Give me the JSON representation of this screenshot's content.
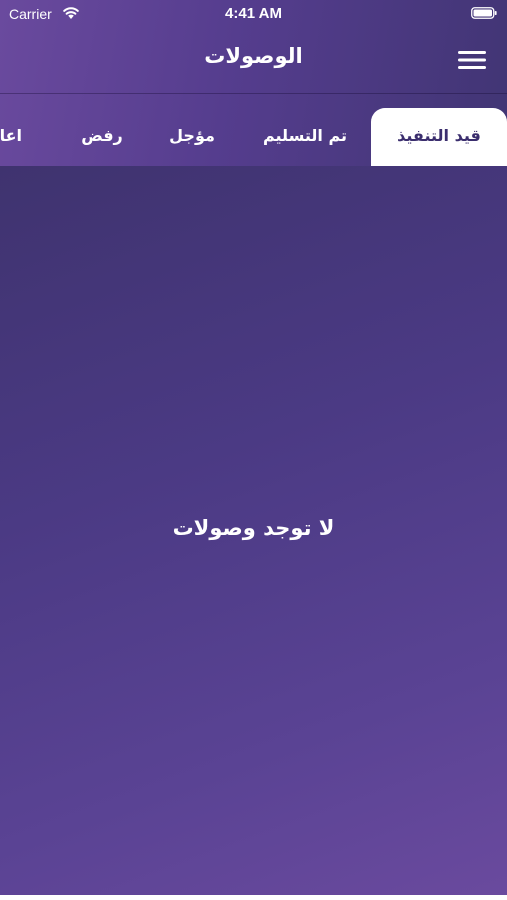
{
  "status_bar": {
    "carrier": "Carrier",
    "time": "4:41 AM",
    "wifi_icon": "wifi-icon",
    "battery_icon": "battery-icon"
  },
  "nav": {
    "title": "الوصولات",
    "menu_icon": "hamburger-menu-icon"
  },
  "tabs": [
    {
      "label": "قيد التنفيذ",
      "active": true
    },
    {
      "label": "تم التسليم",
      "active": false
    },
    {
      "label": "مؤجل",
      "active": false
    },
    {
      "label": "رفض",
      "active": false
    },
    {
      "label": "اعادة",
      "active": false
    }
  ],
  "content": {
    "empty_message": "لا توجد وصولات"
  },
  "colors": {
    "gradient_light": "#6a4a9e",
    "gradient_dark": "#3f336f",
    "active_tab_bg": "#ffffff",
    "active_tab_text": "#3b2e6e",
    "text": "#ffffff"
  }
}
